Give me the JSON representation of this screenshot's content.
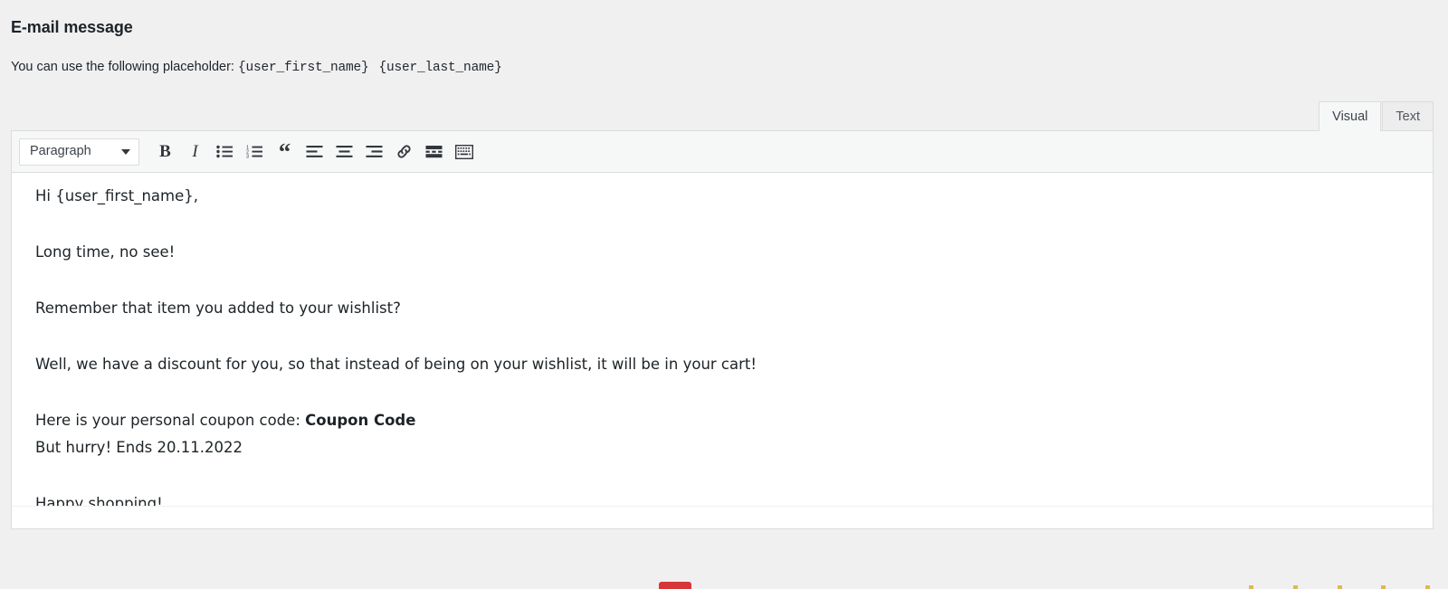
{
  "page": {
    "title": "E-mail message",
    "help_prefix": "You can use the following placeholder:",
    "placeholders": [
      "{user_first_name}",
      "{user_last_name}"
    ]
  },
  "editor": {
    "tabs": [
      {
        "label": "Visual",
        "active": true
      },
      {
        "label": "Text",
        "active": false
      }
    ],
    "toolbar": {
      "format_select": {
        "value": "Paragraph",
        "chevron_icon": "chevron-down-icon"
      },
      "buttons": [
        {
          "name": "bold-button",
          "label": "B",
          "icon": "bold-icon"
        },
        {
          "name": "italic-button",
          "label": "I",
          "icon": "italic-icon"
        },
        {
          "name": "bulleted-list-button",
          "icon": "bulleted-list-icon"
        },
        {
          "name": "numbered-list-button",
          "icon": "numbered-list-icon"
        },
        {
          "name": "blockquote-button",
          "label": "“",
          "icon": "blockquote-icon"
        },
        {
          "name": "align-left-button",
          "icon": "align-left-icon"
        },
        {
          "name": "align-center-button",
          "icon": "align-center-icon"
        },
        {
          "name": "align-right-button",
          "icon": "align-right-icon"
        },
        {
          "name": "insert-link-button",
          "icon": "link-icon"
        },
        {
          "name": "insert-read-more-button",
          "icon": "read-more-icon"
        },
        {
          "name": "toolbar-toggle-button",
          "icon": "keyboard-toolbar-toggle-icon"
        }
      ]
    },
    "body": {
      "paragraph_1": "Hi {user_first_name},",
      "paragraph_2": "Long time, no see!",
      "paragraph_3": "Remember that item you added to your wishlist?",
      "paragraph_4": "Well, we have a discount for you, so that instead of being on your wishlist, it will be in your cart!",
      "paragraph_5_prefix": "Here is your personal coupon code: ",
      "paragraph_5_coupon": "Coupon Code",
      "paragraph_6": "But hurry! Ends 20.11.2022",
      "paragraph_7": "Happy shopping!"
    }
  },
  "colors": {
    "page_background": "#f0f0f1",
    "editor_background": "#ffffff",
    "toolbar_background": "#f6f7f7",
    "border": "#dcdcde",
    "text": "#1d2327",
    "footer_accent_red": "#d63638",
    "footer_accent_yellow": "#dba617"
  }
}
